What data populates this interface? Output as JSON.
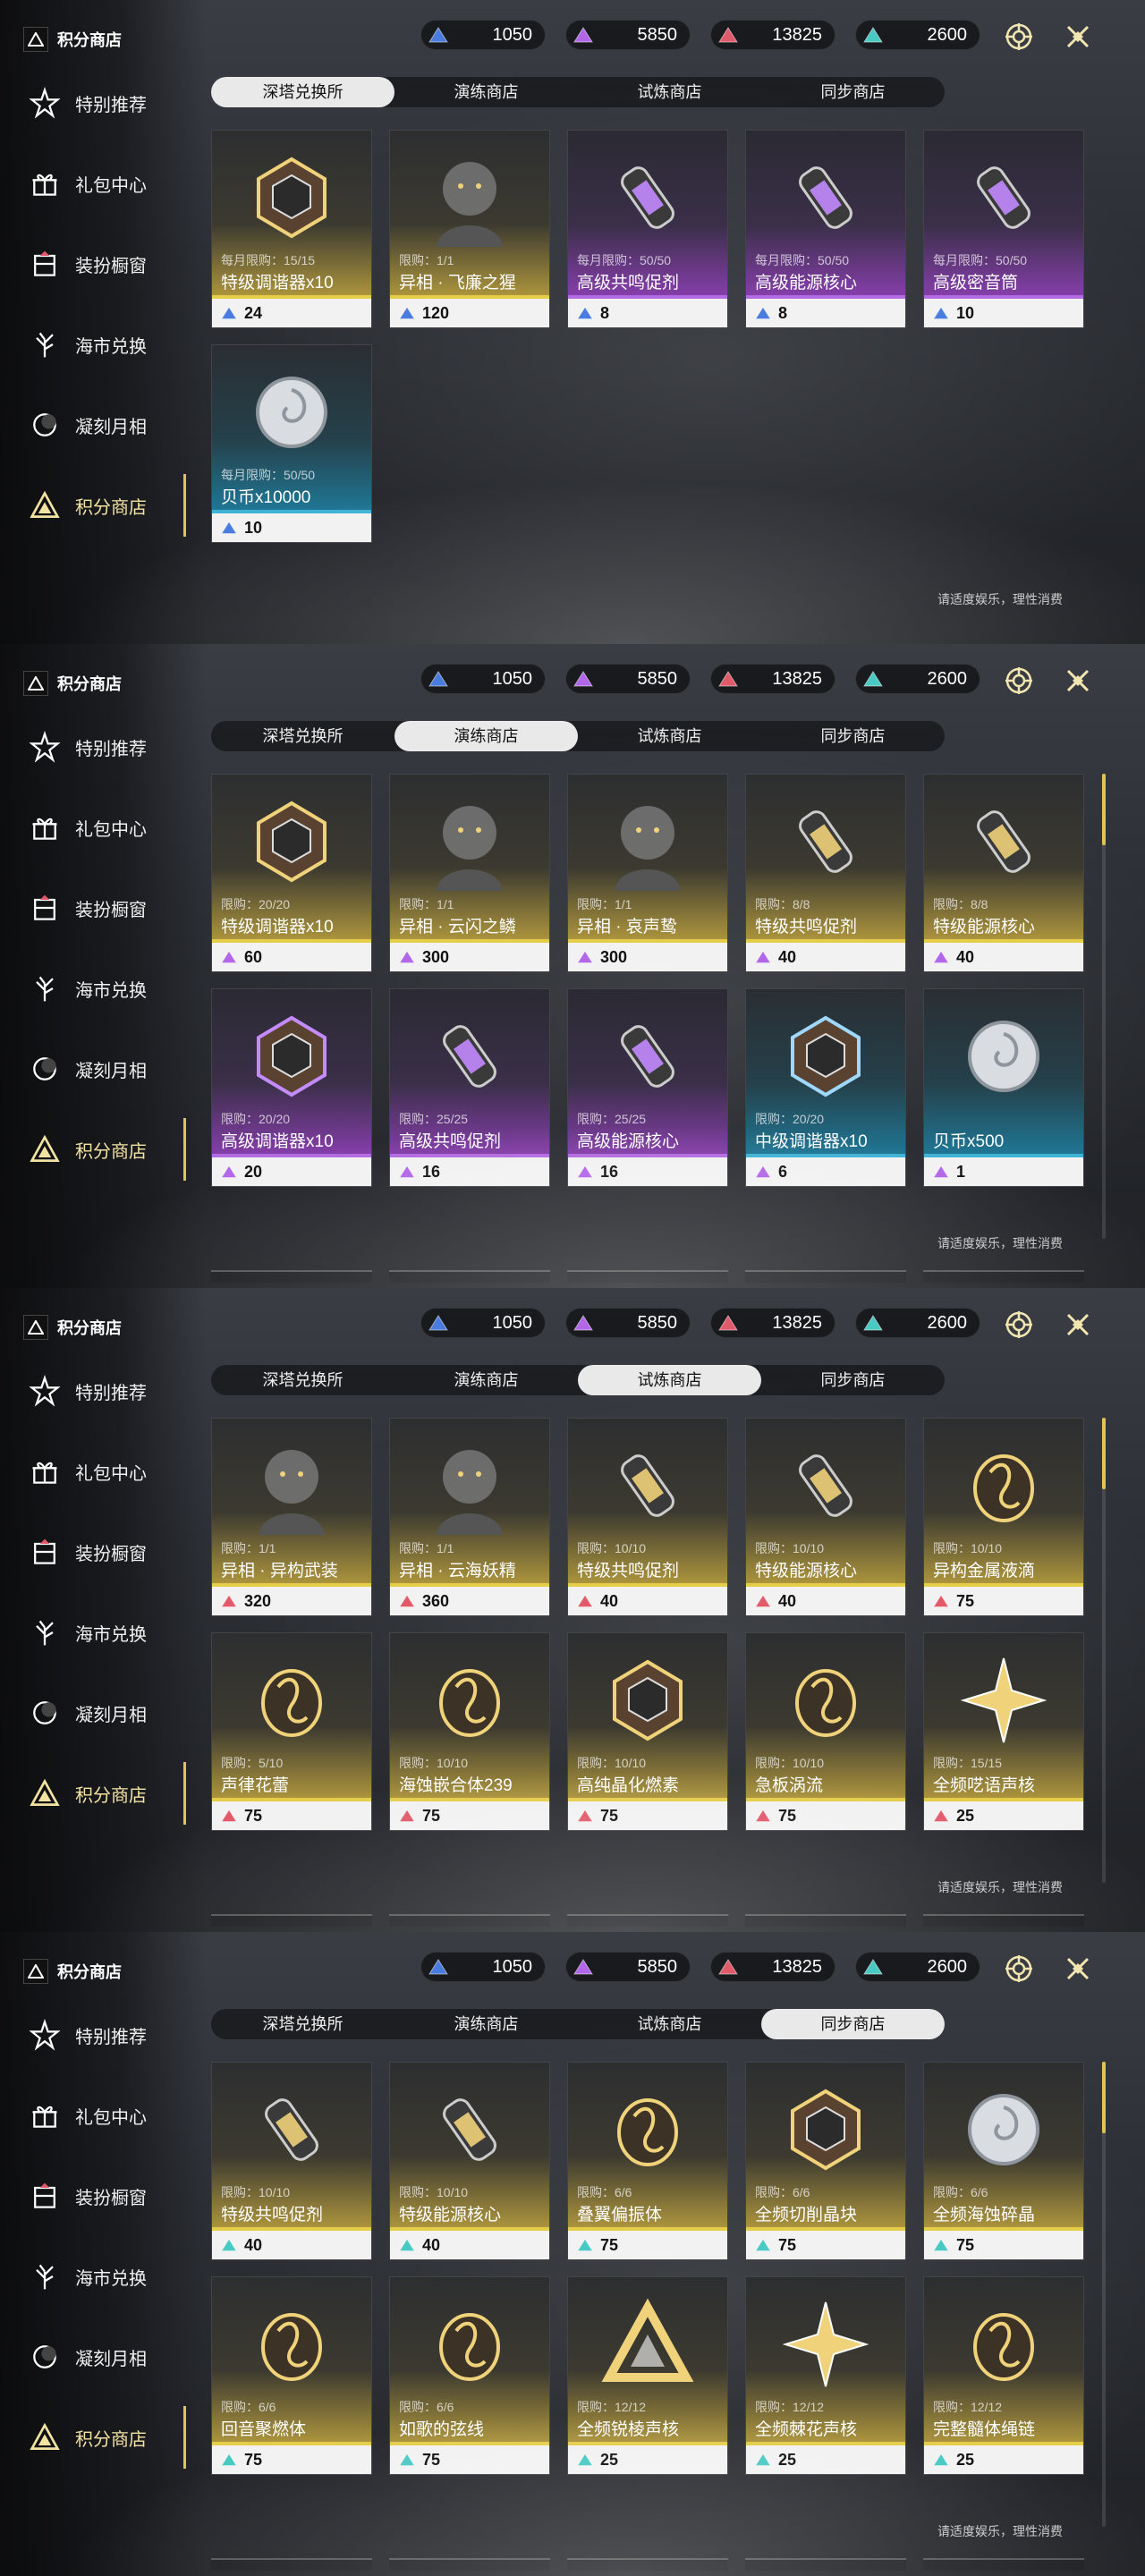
{
  "sidebar": {
    "title": "积分商店",
    "items": [
      {
        "label": "特别推荐",
        "icon": "star-sparkle-icon"
      },
      {
        "label": "礼包中心",
        "icon": "gift-icon"
      },
      {
        "label": "装扮橱窗",
        "icon": "wardrobe-icon"
      },
      {
        "label": "海市兑换",
        "icon": "coral-tree-icon"
      },
      {
        "label": "凝刻月相",
        "icon": "moon-phase-icon"
      },
      {
        "label": "积分商店",
        "icon": "points-triangle-icon"
      }
    ]
  },
  "currencies": [
    {
      "value": "1050",
      "color": "#4a7ce0"
    },
    {
      "value": "5850",
      "color": "#b266e8"
    },
    {
      "value": "13825",
      "color": "#e25a6a"
    },
    {
      "value": "2600",
      "color": "#49c9c4"
    }
  ],
  "tabs": [
    "深塔兑换所",
    "演练商店",
    "试炼商店",
    "同步商店"
  ],
  "notice": "请适度娱乐，理性消费",
  "panels": [
    {
      "active_tab": 0,
      "price_color": "#4a7ce0",
      "items": [
        {
          "name": "特级调谐器x10",
          "limit": "每月限购：15/15",
          "price": "24",
          "rarity": "gold",
          "icon": "tuner-crystal-icon"
        },
        {
          "name": "异相 · 飞廉之猩",
          "limit": "限购：1/1",
          "price": "120",
          "rarity": "gold",
          "icon": "gorilla-portrait-icon"
        },
        {
          "name": "高级共鸣促剂",
          "limit": "每月限购：50/50",
          "price": "8",
          "rarity": "purple",
          "icon": "potion-vial-icon"
        },
        {
          "name": "高级能源核心",
          "limit": "每月限购：50/50",
          "price": "8",
          "rarity": "purple",
          "icon": "energy-core-icon"
        },
        {
          "name": "高级密音筒",
          "limit": "每月限购：50/50",
          "price": "10",
          "rarity": "purple",
          "icon": "sound-tube-icon"
        },
        {
          "name": "贝币x10000",
          "limit": "每月限购：50/50",
          "price": "10",
          "rarity": "blue",
          "icon": "shell-coin-icon"
        }
      ]
    },
    {
      "active_tab": 1,
      "price_color": "#b266e8",
      "items": [
        {
          "name": "特级调谐器x10",
          "limit": "限购：20/20",
          "price": "60",
          "rarity": "gold",
          "icon": "tuner-crystal-icon"
        },
        {
          "name": "异相 · 云闪之鳞",
          "limit": "限购：1/1",
          "price": "300",
          "rarity": "gold",
          "icon": "dragon-portrait-icon"
        },
        {
          "name": "异相 · 哀声鸷",
          "limit": "限购：1/1",
          "price": "300",
          "rarity": "gold",
          "icon": "bird-portrait-icon"
        },
        {
          "name": "特级共鸣促剂",
          "limit": "限购：8/8",
          "price": "40",
          "rarity": "gold",
          "icon": "potion-vial-icon"
        },
        {
          "name": "特级能源核心",
          "limit": "限购：8/8",
          "price": "40",
          "rarity": "gold",
          "icon": "energy-core-icon"
        },
        {
          "name": "高级调谐器x10",
          "limit": "限购：20/20",
          "price": "20",
          "rarity": "purple",
          "icon": "tuner-crystal-icon"
        },
        {
          "name": "高级共鸣促剂",
          "limit": "限购：25/25",
          "price": "16",
          "rarity": "purple",
          "icon": "potion-vial-icon"
        },
        {
          "name": "高级能源核心",
          "limit": "限购：25/25",
          "price": "16",
          "rarity": "purple",
          "icon": "energy-core-icon"
        },
        {
          "name": "中级调谐器x10",
          "limit": "限购：20/20",
          "price": "6",
          "rarity": "blue",
          "icon": "tuner-crystal-icon"
        },
        {
          "name": "贝币x500",
          "limit": "",
          "price": "1",
          "rarity": "blue",
          "icon": "shell-coin-icon"
        }
      ]
    },
    {
      "active_tab": 2,
      "price_color": "#e25a6a",
      "items": [
        {
          "name": "异相 · 异构武装",
          "limit": "限购：1/1",
          "price": "320",
          "rarity": "gold",
          "icon": "armor-portrait-icon"
        },
        {
          "name": "异相 · 云海妖精",
          "limit": "限购：1/1",
          "price": "360",
          "rarity": "gold",
          "icon": "fairy-portrait-icon"
        },
        {
          "name": "特级共鸣促剂",
          "limit": "限购：10/10",
          "price": "40",
          "rarity": "gold",
          "icon": "potion-vial-icon"
        },
        {
          "name": "特级能源核心",
          "limit": "限购：10/10",
          "price": "40",
          "rarity": "gold",
          "icon": "energy-core-icon"
        },
        {
          "name": "异构金属液滴",
          "limit": "限购：10/10",
          "price": "75",
          "rarity": "gold",
          "icon": "metal-droplet-icon"
        },
        {
          "name": "声律花蕾",
          "limit": "限购：5/10",
          "price": "75",
          "rarity": "gold",
          "icon": "flower-bud-icon"
        },
        {
          "name": "海蚀嵌合体239",
          "limit": "限购：10/10",
          "price": "75",
          "rarity": "gold",
          "icon": "chimera-orb-icon"
        },
        {
          "name": "高纯晶化燃素",
          "limit": "限购：10/10",
          "price": "75",
          "rarity": "gold",
          "icon": "flame-crystal-icon"
        },
        {
          "name": "急板涡流",
          "limit": "限购：10/10",
          "price": "75",
          "rarity": "gold",
          "icon": "vortex-icon"
        },
        {
          "name": "全频呓语声核",
          "limit": "限购：15/15",
          "price": "25",
          "rarity": "gold",
          "icon": "star-core-icon"
        }
      ]
    },
    {
      "active_tab": 3,
      "price_color": "#49c9c4",
      "items": [
        {
          "name": "特级共鸣促剂",
          "limit": "限购：10/10",
          "price": "40",
          "rarity": "gold",
          "icon": "potion-vial-icon"
        },
        {
          "name": "特级能源核心",
          "limit": "限购：10/10",
          "price": "40",
          "rarity": "gold",
          "icon": "energy-core-icon"
        },
        {
          "name": "叠翼偏振体",
          "limit": "限购：6/6",
          "price": "75",
          "rarity": "gold",
          "icon": "butterfly-icon"
        },
        {
          "name": "全频切削晶块",
          "limit": "限购：6/6",
          "price": "75",
          "rarity": "gold",
          "icon": "crystal-cube-icon"
        },
        {
          "name": "全频海蚀碎晶",
          "limit": "限购：6/6",
          "price": "75",
          "rarity": "gold",
          "icon": "shard-disc-icon"
        },
        {
          "name": "回音聚燃体",
          "limit": "限购：6/6",
          "price": "75",
          "rarity": "gold",
          "icon": "echo-feather-icon"
        },
        {
          "name": "如歌的弦线",
          "limit": "限购：6/6",
          "price": "75",
          "rarity": "gold",
          "icon": "string-swirl-icon"
        },
        {
          "name": "全频锐棱声核",
          "limit": "限购：12/12",
          "price": "25",
          "rarity": "gold",
          "icon": "triangle-core-icon"
        },
        {
          "name": "全频棘花声核",
          "limit": "限购：12/12",
          "price": "25",
          "rarity": "gold",
          "icon": "thorn-flower-icon"
        },
        {
          "name": "完整髓体绳链",
          "limit": "限购：12/12",
          "price": "25",
          "rarity": "gold",
          "icon": "chain-crown-icon"
        }
      ]
    }
  ]
}
